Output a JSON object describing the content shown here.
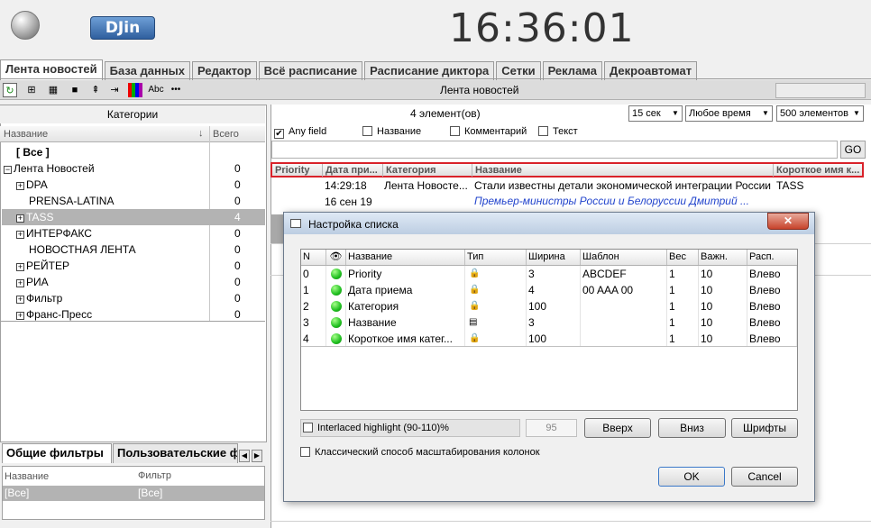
{
  "header": {
    "logo": "DJin",
    "clock": "16:36:01"
  },
  "tabs": [
    "Лента новостей",
    "База данных",
    "Редактор",
    "Всё расписание",
    "Расписание диктора",
    "Сетки",
    "Реклама",
    "Декроавтомат"
  ],
  "toolbar": {
    "title": "Лента новостей",
    "abc_label": "Abc",
    "more_label": "•••"
  },
  "categories": {
    "title": "Категории",
    "col_name": "Название",
    "col_total": "Всего",
    "rows": [
      {
        "label": "[ Все ]",
        "count": "",
        "plus": false,
        "indent": 1,
        "bold": true
      },
      {
        "label": "Лента Новостей",
        "count": "0",
        "plus": true,
        "indent": 0,
        "minus": true
      },
      {
        "label": "DPA",
        "count": "0",
        "plus": true,
        "indent": 1
      },
      {
        "label": "PRENSA-LATINA",
        "count": "0",
        "plus": false,
        "indent": 2
      },
      {
        "label": "TASS",
        "count": "4",
        "plus": true,
        "indent": 1,
        "selected": true
      },
      {
        "label": "ИНТЕРФАКС",
        "count": "0",
        "plus": true,
        "indent": 1
      },
      {
        "label": "НОВОСТНАЯ ЛЕНТА",
        "count": "0",
        "plus": false,
        "indent": 2
      },
      {
        "label": "РЕЙТЕР",
        "count": "0",
        "plus": true,
        "indent": 1
      },
      {
        "label": "РИА",
        "count": "0",
        "plus": true,
        "indent": 1
      },
      {
        "label": "Фильтр",
        "count": "0",
        "plus": true,
        "indent": 1
      },
      {
        "label": "Франс-Пресс",
        "count": "0",
        "plus": true,
        "indent": 1
      }
    ]
  },
  "filters": {
    "tab_general": "Общие фильтры",
    "tab_user": "Пользовательские ф",
    "col_name": "Название",
    "col_filter": "Фильтр",
    "row_name": "[Все]",
    "row_filter": "[Все]"
  },
  "feed": {
    "count_label": "4 элемент(ов)",
    "interval": "15 сек",
    "time": "Любое время",
    "limit": "500 элементов",
    "checks": [
      {
        "label": "Any field",
        "checked": true
      },
      {
        "label": "Название",
        "checked": false
      },
      {
        "label": "Комментарий",
        "checked": false
      },
      {
        "label": "Текст",
        "checked": false
      }
    ],
    "go_label": "GO",
    "columns": [
      "Priority",
      "Дата при...",
      "Категория",
      "Название",
      "Короткое имя к..."
    ],
    "row": {
      "time": "14:29:18",
      "date": "16 сен 19",
      "category": "Лента Новосте...",
      "title": "Стали известны детали экономической интеграции России",
      "subtitle": "Премьер-министры России и Белоруссии Дмитрий ...",
      "short": "TASS"
    }
  },
  "dialog": {
    "title": "Настройка списка",
    "close": "✕",
    "columns": [
      "N",
      "Название",
      "Тип",
      "Ширина",
      "Шаблон",
      "Вес",
      "Важн.",
      "Расп."
    ],
    "rows": [
      {
        "n": "0",
        "name": "Priority",
        "width": "3",
        "template": "ABCDEF",
        "weight": "1",
        "importance": "10",
        "align": "Влево"
      },
      {
        "n": "1",
        "name": "Дата приема",
        "width": "4",
        "template": "00 AAA 00",
        "weight": "1",
        "importance": "10",
        "align": "Влево"
      },
      {
        "n": "2",
        "name": "Категория",
        "width": "100",
        "template": "",
        "weight": "1",
        "importance": "10",
        "align": "Влево"
      },
      {
        "n": "3",
        "name": "Название",
        "width": "3",
        "template": "",
        "weight": "1",
        "importance": "10",
        "align": "Влево"
      },
      {
        "n": "4",
        "name": "Короткое имя катег...",
        "width": "100",
        "template": "",
        "weight": "1",
        "importance": "10",
        "align": "Влево"
      }
    ],
    "interlace_label": "Interlaced highlight (90-110)%",
    "interlace_value": "95",
    "up": "Вверх",
    "down": "Вниз",
    "fonts": "Шрифты",
    "classic_label": "Классический способ масштабирования колонок",
    "ok": "OK",
    "cancel": "Cancel"
  }
}
